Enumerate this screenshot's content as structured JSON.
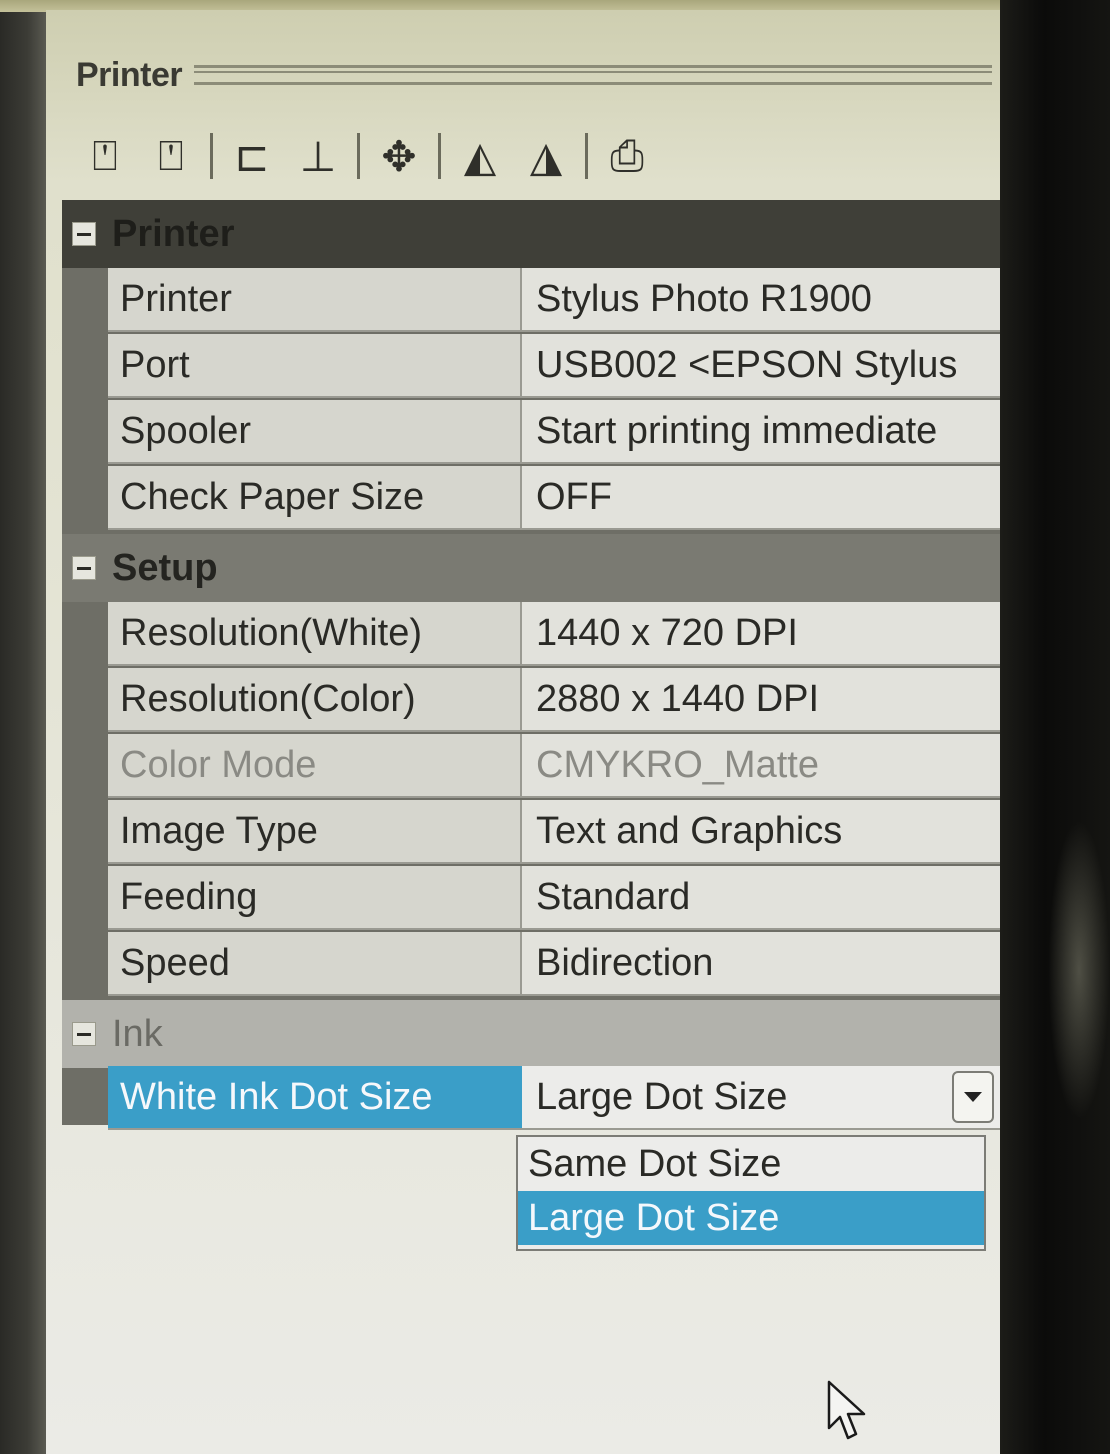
{
  "panel": {
    "title": "Printer",
    "toolbar": [
      {
        "icon": "align-top-left-icon",
        "glyph": "⍞"
      },
      {
        "icon": "align-top-right-icon",
        "glyph": "⍞"
      },
      {
        "icon": "move-horizontal-icon",
        "glyph": "⊏"
      },
      {
        "icon": "move-vertical-icon",
        "glyph": "⊥"
      },
      {
        "icon": "center-icon",
        "glyph": "✥"
      },
      {
        "icon": "flip-rotate-icon",
        "glyph": "◭"
      },
      {
        "icon": "mirror-icon",
        "glyph": "◮"
      },
      {
        "icon": "printer-icon",
        "glyph": "⎙"
      }
    ]
  },
  "categories": {
    "printer": {
      "label": "Printer",
      "rows": [
        {
          "name": "Printer",
          "value": "Stylus Photo R1900"
        },
        {
          "name": "Port",
          "value": "USB002  <EPSON Stylus"
        },
        {
          "name": "Spooler",
          "value": "Start printing immediate"
        },
        {
          "name": "Check Paper Size",
          "value": "OFF"
        }
      ]
    },
    "setup": {
      "label": "Setup",
      "rows": [
        {
          "name": "Resolution(White)",
          "value": "1440 x 720 DPI"
        },
        {
          "name": "Resolution(Color)",
          "value": "2880 x 1440 DPI"
        },
        {
          "name": "Color Mode",
          "value": "CMYKRO_Matte"
        },
        {
          "name": "Image Type",
          "value": "Text and Graphics"
        },
        {
          "name": "Feeding",
          "value": "Standard"
        },
        {
          "name": "Speed",
          "value": "Bidirection"
        }
      ]
    },
    "ink": {
      "label": "Ink",
      "rows": [
        {
          "name": "White Ink Dot Size",
          "value": "Large Dot Size"
        }
      ]
    }
  },
  "dropdown": {
    "options": [
      "Same Dot Size",
      "Large Dot Size"
    ],
    "selected": "Large Dot Size"
  },
  "colors": {
    "selection": "#3a9ec8",
    "category_bg": "#4a4a42",
    "grid_bg": "#d6d6ce"
  }
}
